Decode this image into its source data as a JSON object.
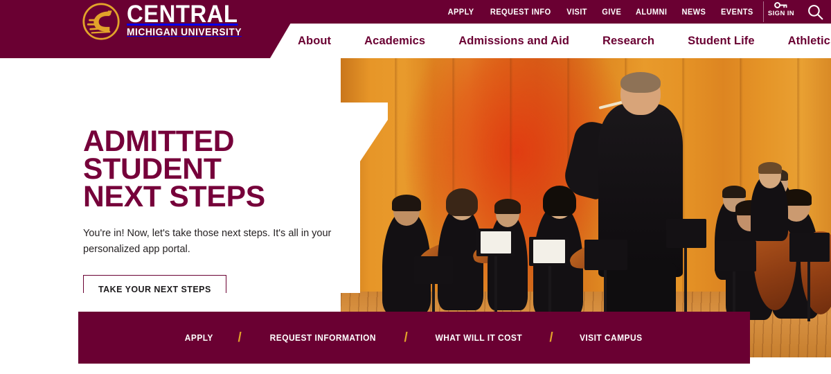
{
  "site": {
    "logo": {
      "icon": "flying-c-logo-icon",
      "line1": "CENTRAL",
      "line2": "MICHIGAN UNIVERSITY"
    },
    "brand_color": "#6A0032",
    "accent_gold": "#E2A32A",
    "headline_color": "#76003A"
  },
  "utility_nav": {
    "items": [
      {
        "label": "APPLY"
      },
      {
        "label": "REQUEST INFO"
      },
      {
        "label": "VISIT"
      },
      {
        "label": "GIVE"
      },
      {
        "label": "ALUMNI"
      },
      {
        "label": "NEWS"
      },
      {
        "label": "EVENTS"
      }
    ],
    "sign_in": {
      "label": "SIGN IN",
      "icon": "key-icon"
    },
    "search": {
      "icon": "search-icon"
    }
  },
  "main_nav": {
    "items": [
      {
        "label": "About"
      },
      {
        "label": "Academics"
      },
      {
        "label": "Admissions and Aid"
      },
      {
        "label": "Research"
      },
      {
        "label": "Student Life"
      },
      {
        "label": "Athletics"
      }
    ]
  },
  "hero": {
    "image_alt": "Orchestra performing on stage with conductor facing the ensemble",
    "card": {
      "headline_line1": "ADMITTED STUDENT",
      "headline_line2": "NEXT STEPS",
      "body": "You're in! Now, let's take those next steps. It's all in your personalized app portal.",
      "button_label": "TAKE YOUR NEXT STEPS"
    }
  },
  "cta_bar": {
    "separator": "/",
    "items": [
      {
        "label": "APPLY"
      },
      {
        "label": "REQUEST INFORMATION"
      },
      {
        "label": "WHAT WILL IT COST"
      },
      {
        "label": "VISIT CAMPUS"
      }
    ]
  }
}
